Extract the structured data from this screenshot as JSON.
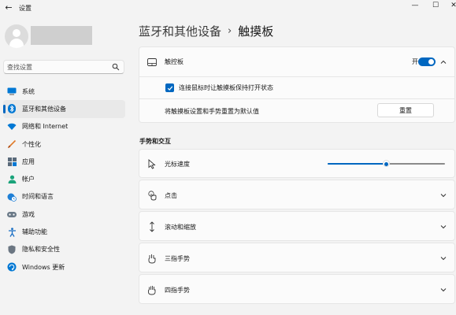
{
  "window": {
    "title": "设置",
    "back_glyph": "←",
    "min_glyph": "—",
    "max_glyph": "☐",
    "close_glyph": "✕"
  },
  "search": {
    "placeholder": "查找设置"
  },
  "sidebar": {
    "items": [
      {
        "label": "系统",
        "icon": "system-icon",
        "active": false
      },
      {
        "label": "蓝牙和其他设备",
        "icon": "bluetooth-icon",
        "active": true
      },
      {
        "label": "网络和 Internet",
        "icon": "wifi-icon",
        "active": false
      },
      {
        "label": "个性化",
        "icon": "brush-icon",
        "active": false
      },
      {
        "label": "应用",
        "icon": "apps-icon",
        "active": false
      },
      {
        "label": "帐户",
        "icon": "account-icon",
        "active": false
      },
      {
        "label": "时间和语言",
        "icon": "globe-clock-icon",
        "active": false
      },
      {
        "label": "游戏",
        "icon": "gamepad-icon",
        "active": false
      },
      {
        "label": "辅助功能",
        "icon": "accessibility-icon",
        "active": false
      },
      {
        "label": "隐私和安全性",
        "icon": "shield-icon",
        "active": false
      },
      {
        "label": "Windows 更新",
        "icon": "update-icon",
        "active": false
      }
    ]
  },
  "breadcrumb": {
    "parent": "蓝牙和其他设备",
    "separator": "›",
    "current": "触摸板"
  },
  "touchpad": {
    "label": "触控板",
    "toggle_text": "开",
    "toggle_on": true,
    "keep_on_with_mouse_label": "连接鼠标时让触摸板保持打开状态",
    "keep_on_checked": true,
    "reset_text": "将触摸板设置和手势重置为默认值",
    "reset_button": "重置"
  },
  "section": {
    "title": "手势和交互"
  },
  "cursor_speed": {
    "label": "光标速度",
    "value_fraction": 0.5
  },
  "expanders": [
    {
      "label": "点击",
      "icon": "tap-icon"
    },
    {
      "label": "滚动和缩放",
      "icon": "scroll-icon"
    },
    {
      "label": "三指手势",
      "icon": "three-finger-icon"
    },
    {
      "label": "四指手势",
      "icon": "four-finger-icon"
    }
  ],
  "colors": {
    "accent": "#0067c0",
    "background": "#f3f3f3",
    "card": "#fbfbfb"
  }
}
